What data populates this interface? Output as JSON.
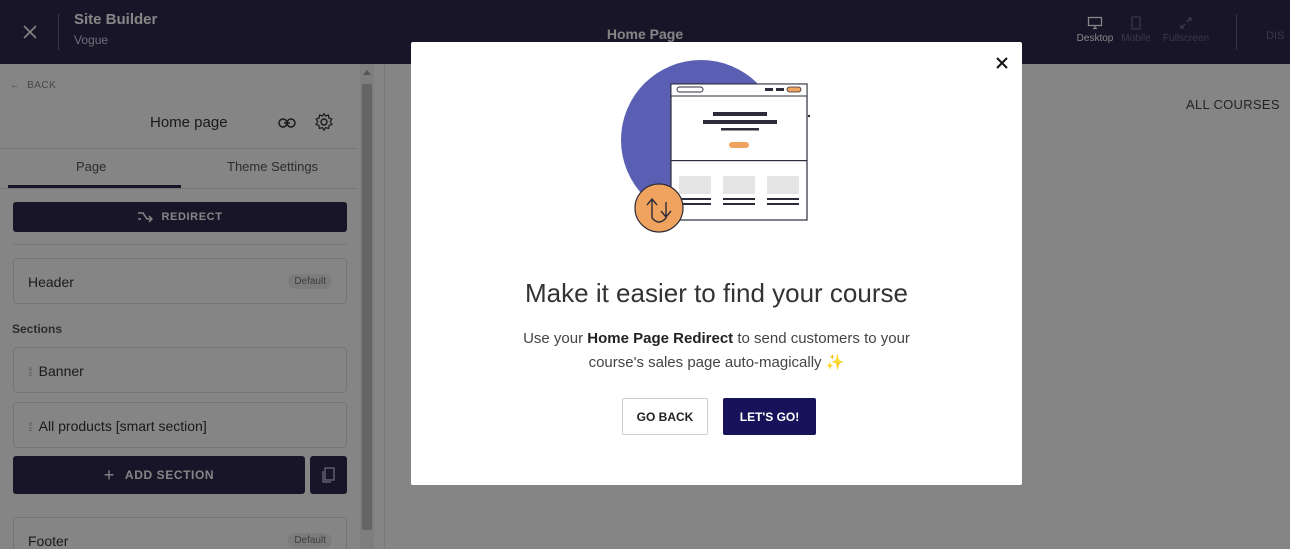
{
  "topbar": {
    "title": "Site Builder",
    "subtitle": "Vogue",
    "page_name": "Home Page",
    "devices": [
      {
        "label": "Desktop",
        "active": true
      },
      {
        "label": "Mobile",
        "active": false
      },
      {
        "label": "Fullscreen",
        "active": false
      }
    ],
    "truncated_action": "DIS"
  },
  "sidebar": {
    "back_label": "BACK",
    "page_title": "Home page",
    "tabs": [
      {
        "label": "Page"
      },
      {
        "label": "Theme Settings"
      }
    ],
    "redirect_label": "REDIRECT",
    "header_label": "Header",
    "header_badge": "Default",
    "sections_label": "Sections",
    "sections": [
      {
        "label": "Banner"
      },
      {
        "label": "All products [smart section]"
      }
    ],
    "add_section_label": "ADD SECTION",
    "footer_label": "Footer",
    "footer_badge": "Default"
  },
  "preview": {
    "nav_link": "ALL COURSES"
  },
  "modal": {
    "title": "Make it easier to find your course",
    "body_prefix": "Use your ",
    "body_bold": "Home Page Redirect",
    "body_suffix": " to send customers to your",
    "body_line2": "course's sales page auto-magically",
    "sparkle": "✨",
    "go_back_label": "GO BACK",
    "lets_go_label": "LET'S GO!"
  },
  "colors": {
    "topbar": "#2e2a4f",
    "primary_button": "#17135b",
    "illustration_circle": "#5b5fb3",
    "illustration_accent": "#f0a35e"
  }
}
